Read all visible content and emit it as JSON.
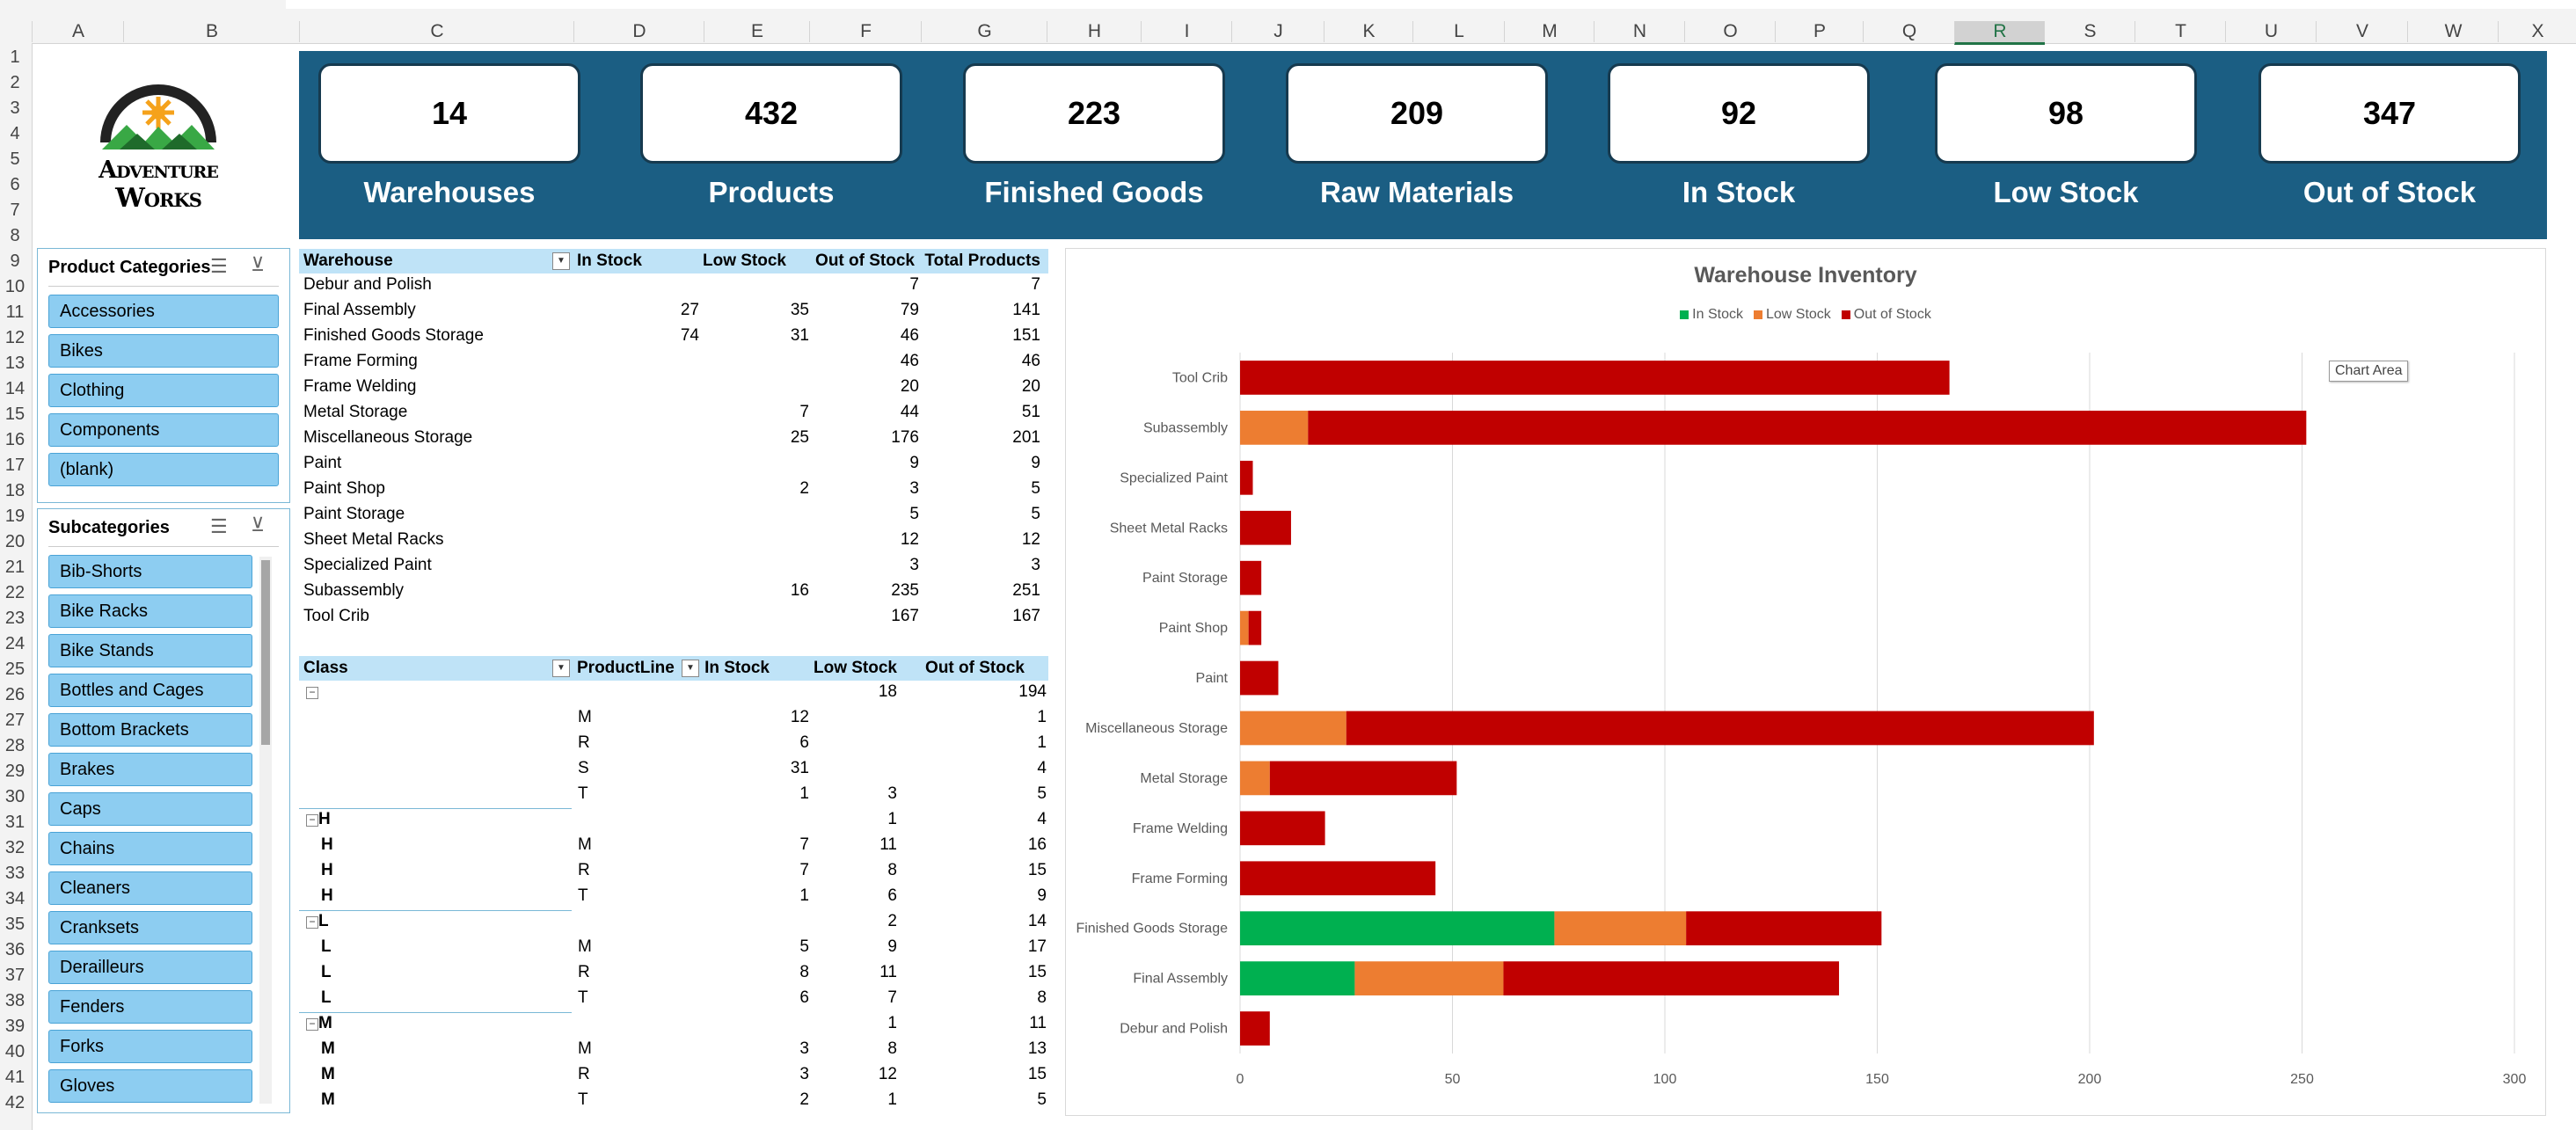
{
  "columns": [
    "A",
    "B",
    "C",
    "D",
    "E",
    "F",
    "G",
    "H",
    "I",
    "J",
    "K",
    "L",
    "M",
    "N",
    "O",
    "P",
    "Q",
    "R",
    "S",
    "T",
    "U",
    "V",
    "W",
    "X"
  ],
  "selected_column": "R",
  "rows": [
    "1",
    "2",
    "3",
    "4",
    "5",
    "6",
    "7",
    "8",
    "9",
    "10",
    "11",
    "12",
    "13",
    "14",
    "15",
    "16",
    "17",
    "18",
    "19",
    "20",
    "21",
    "22",
    "23",
    "24",
    "25",
    "26",
    "27",
    "28",
    "29",
    "30",
    "31",
    "32",
    "33",
    "34",
    "35",
    "36",
    "37",
    "38",
    "39",
    "40",
    "41",
    "42"
  ],
  "logo": {
    "line1": "Adventure",
    "line2": "Works"
  },
  "kpis": [
    {
      "value": "14",
      "label": "Warehouses"
    },
    {
      "value": "432",
      "label": "Products"
    },
    {
      "value": "223",
      "label": "Finished Goods"
    },
    {
      "value": "209",
      "label": "Raw Materials"
    },
    {
      "value": "92",
      "label": "In Stock"
    },
    {
      "value": "98",
      "label": "Low Stock"
    },
    {
      "value": "347",
      "label": "Out of Stock"
    }
  ],
  "slicer_categories": {
    "title": "Product Categories",
    "items": [
      "Accessories",
      "Bikes",
      "Clothing",
      "Components",
      "(blank)"
    ]
  },
  "slicer_subcategories": {
    "title": "Subcategories",
    "items": [
      "Bib-Shorts",
      "Bike Racks",
      "Bike Stands",
      "Bottles and Cages",
      "Bottom Brackets",
      "Brakes",
      "Caps",
      "Chains",
      "Cleaners",
      "Cranksets",
      "Derailleurs",
      "Fenders",
      "Forks",
      "Gloves"
    ]
  },
  "pivot_warehouse": {
    "headers": [
      "Warehouse",
      "In Stock",
      "Low Stock",
      "Out of Stock",
      "Total Products"
    ],
    "rows": [
      [
        "Debur and Polish",
        "",
        "",
        "7",
        "7"
      ],
      [
        "Final Assembly",
        "27",
        "35",
        "79",
        "141"
      ],
      [
        "Finished Goods Storage",
        "74",
        "31",
        "46",
        "151"
      ],
      [
        "Frame Forming",
        "",
        "",
        "46",
        "46"
      ],
      [
        "Frame Welding",
        "",
        "",
        "20",
        "20"
      ],
      [
        "Metal Storage",
        "",
        "7",
        "44",
        "51"
      ],
      [
        "Miscellaneous Storage",
        "",
        "25",
        "176",
        "201"
      ],
      [
        "Paint",
        "",
        "",
        "9",
        "9"
      ],
      [
        "Paint Shop",
        "",
        "2",
        "3",
        "5"
      ],
      [
        "Paint Storage",
        "",
        "",
        "5",
        "5"
      ],
      [
        "Sheet Metal Racks",
        "",
        "",
        "12",
        "12"
      ],
      [
        "Specialized Paint",
        "",
        "",
        "3",
        "3"
      ],
      [
        "Subassembly",
        "",
        "16",
        "235",
        "251"
      ],
      [
        "Tool Crib",
        "",
        "",
        "167",
        "167"
      ]
    ]
  },
  "pivot_class": {
    "headers": [
      "Class",
      "ProductLine",
      "In Stock",
      "Low Stock",
      "Out of Stock"
    ],
    "rows": [
      {
        "cls": "",
        "line": "",
        "instock": "",
        "low": "18",
        "out": "194",
        "group": true,
        "minus": true
      },
      {
        "cls": "",
        "line": "M",
        "instock": "12",
        "low": "",
        "out": "1"
      },
      {
        "cls": "",
        "line": "R",
        "instock": "6",
        "low": "",
        "out": "1"
      },
      {
        "cls": "",
        "line": "S",
        "instock": "31",
        "low": "",
        "out": "4"
      },
      {
        "cls": "",
        "line": "T",
        "instock": "1",
        "low": "3",
        "out": "5",
        "underline": true
      },
      {
        "cls": "H",
        "line": "",
        "instock": "",
        "low": "1",
        "out": "4",
        "group": true,
        "minus": true
      },
      {
        "cls": "H",
        "line": "M",
        "instock": "7",
        "low": "11",
        "out": "16"
      },
      {
        "cls": "H",
        "line": "R",
        "instock": "7",
        "low": "8",
        "out": "15"
      },
      {
        "cls": "H",
        "line": "T",
        "instock": "1",
        "low": "6",
        "out": "9",
        "underline": true
      },
      {
        "cls": "L",
        "line": "",
        "instock": "",
        "low": "2",
        "out": "14",
        "group": true,
        "minus": true
      },
      {
        "cls": "L",
        "line": "M",
        "instock": "5",
        "low": "9",
        "out": "17"
      },
      {
        "cls": "L",
        "line": "R",
        "instock": "8",
        "low": "11",
        "out": "15"
      },
      {
        "cls": "L",
        "line": "T",
        "instock": "6",
        "low": "7",
        "out": "8",
        "underline": true
      },
      {
        "cls": "M",
        "line": "",
        "instock": "",
        "low": "1",
        "out": "11",
        "group": true,
        "minus": true
      },
      {
        "cls": "M",
        "line": "M",
        "instock": "3",
        "low": "8",
        "out": "13"
      },
      {
        "cls": "M",
        "line": "R",
        "instock": "3",
        "low": "12",
        "out": "15"
      },
      {
        "cls": "M",
        "line": "T",
        "instock": "2",
        "low": "1",
        "out": "5"
      }
    ]
  },
  "chart_data": {
    "type": "bar",
    "orientation": "horizontal",
    "stacked": true,
    "title": "Warehouse Inventory",
    "tooltip": "Chart Area",
    "categories": [
      "Tool Crib",
      "Subassembly",
      "Specialized Paint",
      "Sheet Metal Racks",
      "Paint Storage",
      "Paint Shop",
      "Paint",
      "Miscellaneous Storage",
      "Metal Storage",
      "Frame Welding",
      "Frame Forming",
      "Finished Goods Storage",
      "Final Assembly",
      "Debur and Polish"
    ],
    "series": [
      {
        "name": "In Stock",
        "color": "#00b050",
        "values": [
          0,
          0,
          0,
          0,
          0,
          0,
          0,
          0,
          0,
          0,
          0,
          74,
          27,
          0
        ]
      },
      {
        "name": "Low Stock",
        "color": "#ed7d31",
        "values": [
          0,
          16,
          0,
          0,
          0,
          2,
          0,
          25,
          7,
          0,
          0,
          31,
          35,
          0
        ]
      },
      {
        "name": "Out of Stock",
        "color": "#c00000",
        "values": [
          167,
          235,
          3,
          12,
          5,
          3,
          9,
          176,
          44,
          20,
          46,
          46,
          79,
          7
        ]
      }
    ],
    "xlim": [
      0,
      300
    ],
    "xticks": [
      "0",
      "50",
      "100",
      "150",
      "200",
      "250",
      "300"
    ],
    "legend_position": "top",
    "grid": true
  }
}
